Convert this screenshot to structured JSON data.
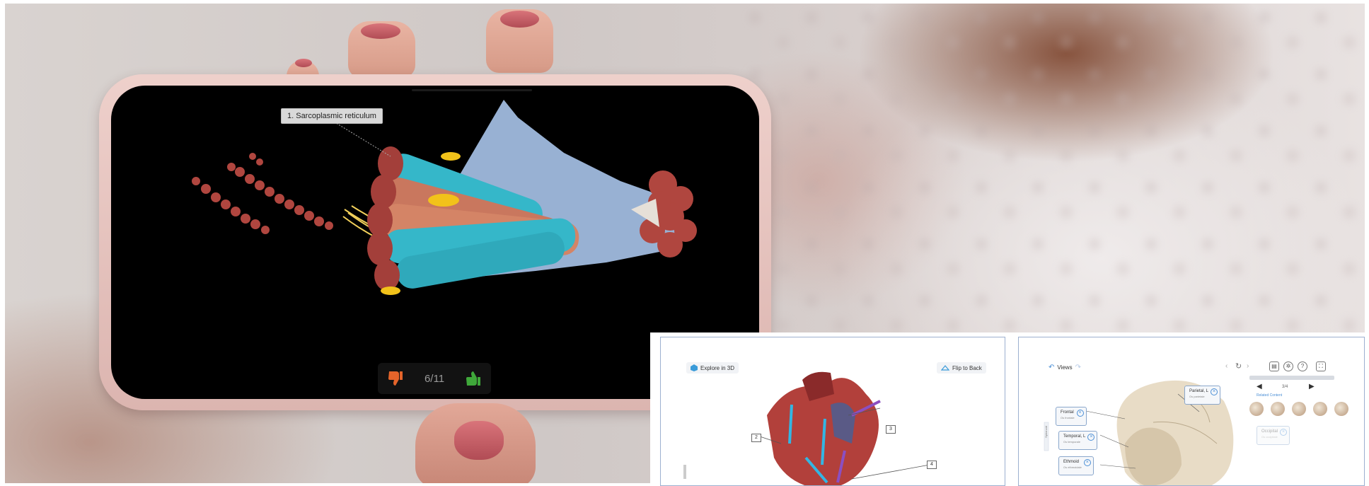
{
  "phone_app": {
    "callout_label": "1. Sarcoplasmic reticulum",
    "counter": "6/11",
    "thumb_down_color": "#e4642a",
    "thumb_up_color": "#3fa83a"
  },
  "heart_panel": {
    "explore_label": "Explore in 3D",
    "flip_label": "Flip to Back",
    "tags": [
      "2",
      "3",
      "4"
    ]
  },
  "skull_panel": {
    "views_label": "Views",
    "side_tab": "Sphenoid",
    "pager": "3/4",
    "related_label": "Related Content",
    "labels": {
      "parietal": "Parietal, L",
      "parietal_sub": "Os parietale",
      "frontal": "Frontal",
      "frontal_sub": "Os frontale",
      "temporal": "Temporal, L",
      "temporal_sub": "Os temporale",
      "ethmoid": "Ethmoid",
      "ethmoid_sub": "Os ethmoidale",
      "occipital": "Occipital",
      "occipital_sub": "Os occipitale"
    }
  },
  "colors": {
    "muscle": "#c9775e",
    "reticulum": "#33b6c9",
    "panel_border": "#9db0d0",
    "accent_blue": "#4b8fd6"
  }
}
